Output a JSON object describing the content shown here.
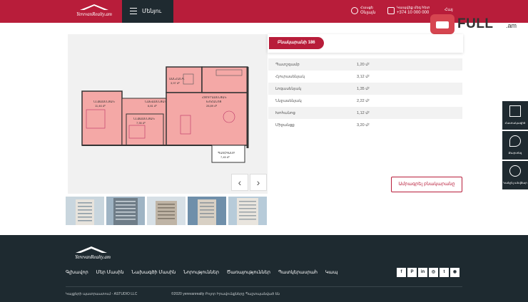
{
  "header": {
    "logo_text": "YerevanRealty.am",
    "menu_label": "Մենյու",
    "contact1_title": "Հասցե",
    "contact1_value": "Օնլայն",
    "contact2_title": "Կապվեք մեզ հետ",
    "contact2_value": "+374 10 000 000",
    "language": "Հայ"
  },
  "watermark": {
    "brand": "FULL",
    "tld": ".am"
  },
  "apartment": {
    "title": "Բնակարանի 186",
    "specs": [
      {
        "label": "Պատշգամբ",
        "value": "1,20 մ²"
      },
      {
        "label": "Հյուրասենյակ",
        "value": "3,12 մ²"
      },
      {
        "label": "Լոգասենյակ",
        "value": "1,35 մ²"
      },
      {
        "label": "Ննջասենյակ",
        "value": "2,22 մ²"
      },
      {
        "label": "Խոհանոց",
        "value": "1,12 մ²"
      },
      {
        "label": "Միջանցք",
        "value": "3,20 մ²"
      }
    ],
    "book_button": "Ամրագրել բնակարանը"
  },
  "floorplan": {
    "labels": {
      "bath": "ՍԱՆՀԱՆԳՈՒՅՑ\n3,97 մ²",
      "bedroom": "ՆՆՋԱՍԵՆՅԱԿ\n11,46 մ²",
      "hall": "ՆԱԽԱՍԵՆՅԱԿ\n6,81 մ²",
      "living": "ՀՅՈՒՐԱՍԵՆՅԱԿ\nԽՈՀԱՆՈՑ\n28,89 մ²",
      "bedroom2": "ՆՆՋԱՍԵՆՅԱԿ\n7,35 մ²",
      "balcony": "ՊԱՏՇԳԱՄԲ\n7,45 մ²"
    }
  },
  "gallery": {
    "prev": "‹",
    "next": "›",
    "thumb_count": 5
  },
  "side_tools": [
    {
      "label": "Հատակագիծ",
      "icon": "floorplan-icon"
    },
    {
      "label": "Քարտեզ",
      "icon": "map-icon"
    },
    {
      "label": "Կանչել\nանվճար",
      "icon": "phone-icon"
    }
  ],
  "footer": {
    "logo_text": "YerevanRealty.am",
    "nav": [
      "Գլխավոր",
      "Մեր Մասին",
      "Նախագծի Մասին",
      "Նորություններ",
      "Ծառայություններ",
      "Պատկերասրահ",
      "Կապ"
    ],
    "social": [
      "f",
      "P",
      "in",
      "◎",
      "t",
      "◉"
    ],
    "credit": "Կայքերի պատրաստում - ASTUDIO LLC",
    "copyright": "©2020 yerevanrealty Բոլոր Իրավունքները Պաշտպանված են"
  },
  "colors": {
    "brand": "#b81d3a",
    "dark": "#1f2a30",
    "plan_fill": "#f4a8a6"
  }
}
